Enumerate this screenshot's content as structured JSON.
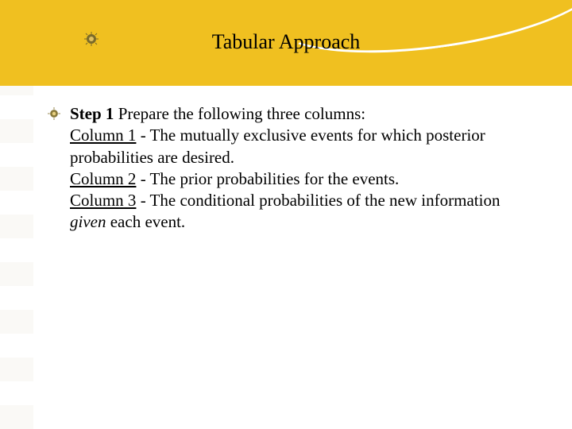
{
  "title": "Tabular Approach",
  "step_label": "Step 1",
  "step_text": "  Prepare the following three columns:",
  "col1_label": "Column 1",
  "col1_text": " -  The mutually exclusive events for which posterior probabilities are desired.",
  "col2_label": "Column 2",
  "col2_text": " -  The prior probabilities for the events.",
  "col3_label": "Column 3",
  "col3_text_a": " -  The conditional probabilities of the new information ",
  "col3_given": "given",
  "col3_text_b": "  each event."
}
